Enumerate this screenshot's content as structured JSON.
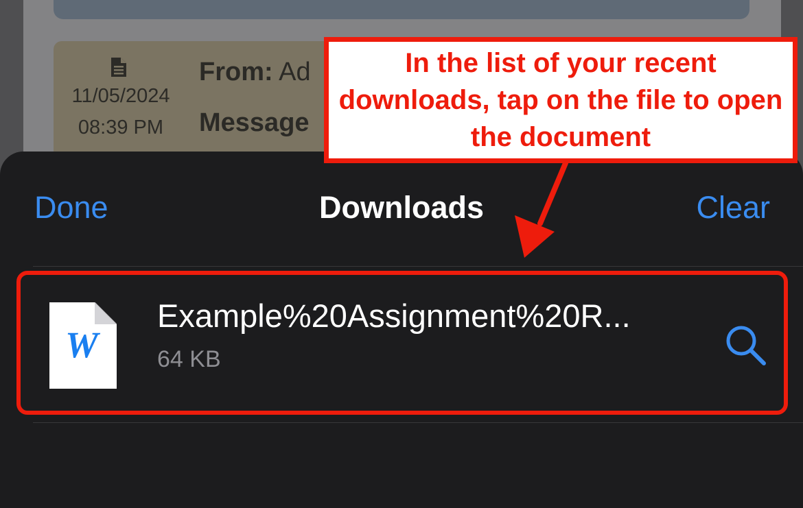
{
  "background_page": {
    "message": {
      "date": "11/05/2024",
      "time": "08:39 PM",
      "from_label": "From:",
      "from_value": "Ad",
      "message_label": "Message"
    }
  },
  "downloads_sheet": {
    "done_label": "Done",
    "title": "Downloads",
    "clear_label": "Clear",
    "files": [
      {
        "name": "Example%20Assignment%20R...",
        "size": "64 KB",
        "icon": "word-document-icon",
        "icon_letter": "W"
      }
    ]
  },
  "annotation": {
    "callout_text": "In the list of your recent downloads, tap on the file to open the document"
  },
  "colors": {
    "accent_blue": "#3a8cf0",
    "annotation_red": "#ee1c0c",
    "sheet_background": "#1c1c1e"
  }
}
